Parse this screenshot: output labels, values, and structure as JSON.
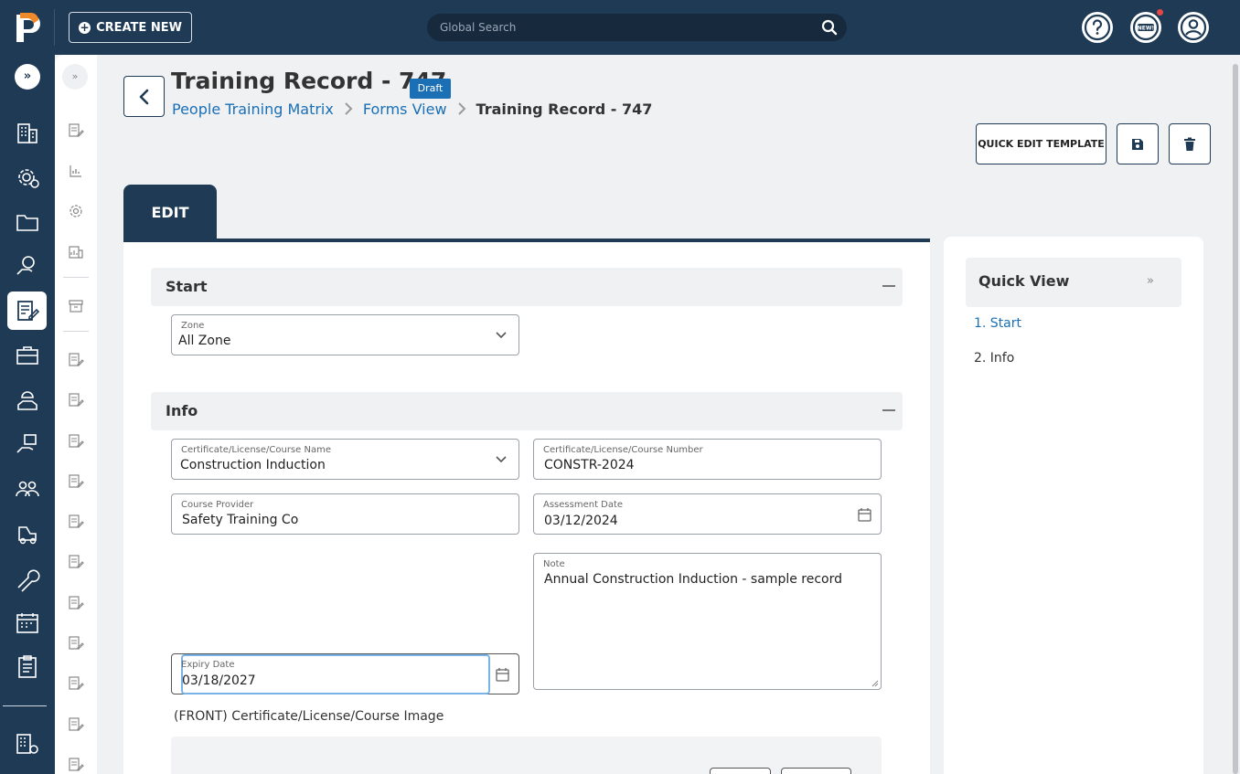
{
  "topbar": {
    "create_label": "CREATE NEW",
    "search_placeholder": "Global Search",
    "help_icon": "help-circle-icon",
    "news_icon": "new-badge-icon",
    "user_icon": "user-avatar-icon",
    "accent_color": "#1f3a55",
    "notification_color": "#e04848"
  },
  "rail": {
    "icons": [
      "buildings-icon",
      "gear-alert-icon",
      "folder-icon",
      "hand-money-icon",
      "form-edit-icon",
      "briefcase-icon",
      "worker-icon",
      "box-hand-icon",
      "people-icon",
      "forklift-icon",
      "wrench-icon",
      "calendar-icon",
      "clipboard-icon",
      "building-settings-icon"
    ]
  },
  "header": {
    "title": "Training Record - 747",
    "status_badge": "Draft",
    "breadcrumb": [
      "People Training Matrix",
      "Forms View",
      "Training Record - 747"
    ],
    "quick_edit_label": "QUICK EDIT TEMPLATE"
  },
  "tabs": {
    "edit_label": "EDIT"
  },
  "sections": {
    "start_title": "Start",
    "info_title": "Info"
  },
  "fields": {
    "zone_label": "Zone",
    "zone_value": "All Zone",
    "course_name_label": "Certificate/License/Course Name",
    "course_name_value": "Construction Induction",
    "course_number_label": "Certificate/License/Course Number",
    "course_number_value": "CONSTR-2024",
    "provider_label": "Course Provider",
    "provider_value": "Safety Training Co",
    "assessment_label": "Assessment Date",
    "assessment_value": "03/12/2024",
    "note_label": "Note",
    "note_value": "Annual Construction Induction - sample record",
    "expiry_label": "Expiry Date",
    "expiry_value": "03/18/2027",
    "image_label": "(FRONT) Certificate/License/Course Image"
  },
  "quick_view": {
    "title": "Quick View",
    "items": [
      "1. Start",
      "2. Info"
    ],
    "active_color": "#1a6fb5"
  }
}
